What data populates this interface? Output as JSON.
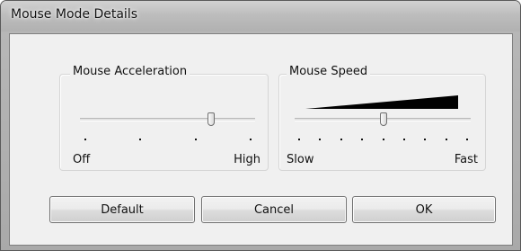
{
  "window": {
    "title": "Mouse Mode Details"
  },
  "mouse_acceleration": {
    "label": "Mouse Acceleration",
    "min_label": "Off",
    "max_label": "High",
    "tick_count": 4,
    "value_fraction": 0.76
  },
  "mouse_speed": {
    "label": "Mouse Speed",
    "min_label": "Slow",
    "max_label": "Fast",
    "tick_count": 9,
    "value_fraction": 0.5
  },
  "buttons": {
    "default_label": "Default",
    "cancel_label": "Cancel",
    "ok_label": "OK"
  }
}
